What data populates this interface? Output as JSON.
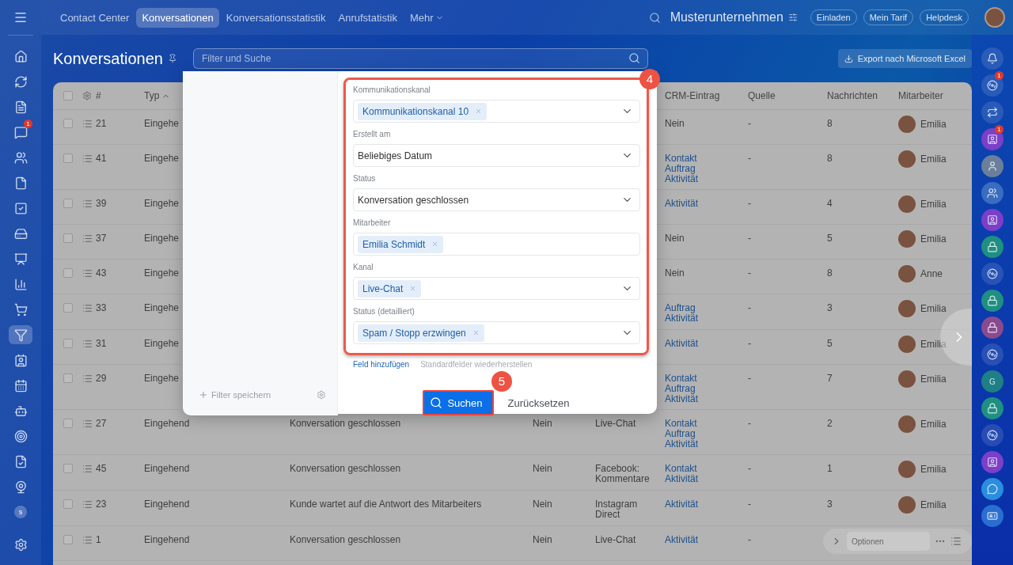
{
  "top_nav": {
    "tabs": [
      {
        "label": "Contact Center",
        "selected": false
      },
      {
        "label": "Konversationen",
        "selected": true
      },
      {
        "label": "Konversationsstatistik",
        "selected": false
      },
      {
        "label": "Anrufstatistik",
        "selected": false
      }
    ],
    "more": "Mehr",
    "company": "Musterunternehmen",
    "buttons": [
      "Einladen",
      "Mein Tarif",
      "Helpdesk"
    ]
  },
  "left_rail": {
    "items": [
      {
        "kind": "home",
        "selected": false
      },
      {
        "kind": "cycle",
        "selected": false
      },
      {
        "kind": "feed",
        "selected": false
      },
      {
        "kind": "chat",
        "selected": false,
        "badge": "1"
      },
      {
        "kind": "users",
        "selected": false
      },
      {
        "kind": "doc",
        "selected": false
      },
      {
        "kind": "tasks",
        "selected": false
      },
      {
        "kind": "drive",
        "selected": false
      },
      {
        "kind": "board",
        "selected": false
      },
      {
        "kind": "chart",
        "selected": false
      },
      {
        "kind": "cart",
        "selected": false
      },
      {
        "kind": "funnel",
        "selected": true
      },
      {
        "kind": "card",
        "selected": false
      },
      {
        "kind": "calendar",
        "selected": false
      },
      {
        "kind": "bot",
        "selected": false
      },
      {
        "kind": "target",
        "selected": false
      },
      {
        "kind": "sign",
        "selected": false
      },
      {
        "kind": "camera",
        "selected": false
      },
      {
        "kind": "letter",
        "label": "s",
        "selected": false
      }
    ]
  },
  "page": {
    "title": "Konversationen",
    "search": {
      "placeholder": "Filter und Suche"
    },
    "export_button": "Export nach Microsoft Excel"
  },
  "table": {
    "columns": {
      "number": "#",
      "type": "Typ",
      "crm": "CRM-Eintrag",
      "source": "Quelle",
      "messages": "Nachrichten",
      "employee": "Mitarbeiter"
    },
    "all_checked": false,
    "sort_ascending": true,
    "rows": [
      {
        "checked": false,
        "number": "21",
        "type": "Eingehe",
        "crm": [
          {
            "text": "Nein",
            "link": false
          }
        ],
        "source": "-",
        "messages": "8",
        "employee": "Emilia"
      },
      {
        "checked": false,
        "number": "41",
        "type": "Eingehe",
        "crm": [
          {
            "text": "Kontakt",
            "link": true
          },
          {
            "text": "Auftrag",
            "link": true
          },
          {
            "text": "Aktivität",
            "link": true
          }
        ],
        "source": "-",
        "messages": "8",
        "employee": "Emilia"
      },
      {
        "checked": false,
        "number": "39",
        "type": "Eingehe",
        "crm": [
          {
            "text": "Aktivität",
            "link": true
          }
        ],
        "source": "-",
        "messages": "4",
        "employee": "Emilia"
      },
      {
        "checked": false,
        "number": "37",
        "type": "Eingehe",
        "crm": [
          {
            "text": "Nein",
            "link": false
          }
        ],
        "source": "-",
        "messages": "5",
        "employee": "Emilia"
      },
      {
        "checked": false,
        "number": "43",
        "type": "Eingehe",
        "crm": [
          {
            "text": "Nein",
            "link": false
          }
        ],
        "source": "-",
        "messages": "8",
        "employee": "Anne"
      },
      {
        "checked": false,
        "number": "33",
        "type": "Eingehe",
        "crm": [
          {
            "text": "Auftrag",
            "link": true
          },
          {
            "text": "Aktivität",
            "link": true
          }
        ],
        "source": "-",
        "messages": "3",
        "employee": "Emilia"
      },
      {
        "checked": false,
        "number": "31",
        "type": "Eingehe",
        "crm": [
          {
            "text": "Aktivität",
            "link": true
          }
        ],
        "source": "-",
        "messages": "5",
        "employee": "Emilia"
      },
      {
        "checked": false,
        "number": "29",
        "type": "Eingehe",
        "crm": [
          {
            "text": "Kontakt",
            "link": true
          },
          {
            "text": "Auftrag",
            "link": true
          },
          {
            "text": "Aktivität",
            "link": true
          }
        ],
        "source": "-",
        "messages": "7",
        "employee": "Emilia"
      },
      {
        "checked": false,
        "number": "27",
        "type": "Eingehend",
        "status": "Konversation geschlossen",
        "column_5": "Nein",
        "column_6": "Live-Chat",
        "crm": [
          {
            "text": "Kontakt",
            "link": true
          },
          {
            "text": "Auftrag",
            "link": true
          },
          {
            "text": "Aktivität",
            "link": true
          }
        ],
        "source": "-",
        "messages": "2",
        "employee": "Emilia"
      },
      {
        "checked": false,
        "number": "45",
        "type": "Eingehend",
        "status": "Konversation geschlossen",
        "column_5": "Nein",
        "column_6": "Facebook: Kommentare",
        "crm": [
          {
            "text": "Kontakt",
            "link": true
          },
          {
            "text": "Aktivität",
            "link": true
          }
        ],
        "source": "-",
        "messages": "1",
        "employee": "Emilia"
      },
      {
        "checked": false,
        "number": "23",
        "type": "Eingehend",
        "status": "Kunde wartet auf die Antwort des Mitarbeiters",
        "column_5": "Nein",
        "column_6": "Instagram Direct",
        "crm": [
          {
            "text": "Aktivität",
            "link": true
          }
        ],
        "source": "-",
        "messages": "3",
        "employee": "Emilia"
      },
      {
        "checked": false,
        "number": "1",
        "type": "Eingehend",
        "status": "Konversation geschlossen",
        "column_5": "Nein",
        "column_6": "Live-Chat",
        "crm": [
          {
            "text": "Aktivität",
            "link": true
          }
        ],
        "source": "-"
      }
    ]
  },
  "filter_popup": {
    "save_filter": "Filter speichern",
    "marker_fields": "4",
    "fields": [
      {
        "label": "Kommunikationskanal",
        "kind": "tags",
        "tags": [
          "Kommunikationskanal 10"
        ],
        "dropdown": true
      },
      {
        "label": "Erstellt am",
        "kind": "select",
        "value": "Beliebiges Datum",
        "dropdown": true
      },
      {
        "label": "Status",
        "kind": "select",
        "value": "Konversation geschlossen",
        "dropdown": true
      },
      {
        "label": "Mitarbeiter",
        "kind": "tags",
        "tags": [
          "Emilia Schmidt"
        ],
        "dropdown": false
      },
      {
        "label": "Kanal",
        "kind": "tags",
        "tags": [
          "Live-Chat"
        ],
        "dropdown": true
      },
      {
        "label": "Status (detailliert)",
        "kind": "tags",
        "tags": [
          "Spam / Stopp erzwingen"
        ],
        "dropdown": true
      }
    ],
    "add_field": "Feld hinzufügen",
    "restore_fields": "Standardfelder wiederherstellen",
    "search_button": "Suchen",
    "marker_search": "5",
    "reset_button": "Zurücksetzen"
  },
  "right_rail": {
    "items": [
      {
        "kind": "bell"
      },
      {
        "kind": "spiral",
        "badge": "1"
      },
      {
        "kind": "swap"
      },
      {
        "kind": "app",
        "badge": "1"
      },
      {
        "kind": "person"
      },
      {
        "kind": "group"
      },
      {
        "kind": "app"
      },
      {
        "kind": "lock"
      },
      {
        "kind": "spiral"
      },
      {
        "kind": "lock"
      },
      {
        "kind": "lock-alt"
      },
      {
        "kind": "spiral"
      },
      {
        "kind": "letter",
        "label": "G"
      },
      {
        "kind": "lock"
      },
      {
        "kind": "spiral"
      },
      {
        "kind": "app"
      },
      {
        "kind": "chat"
      },
      {
        "kind": "card"
      }
    ]
  },
  "options_bar": {
    "placeholder": "Optionen"
  }
}
